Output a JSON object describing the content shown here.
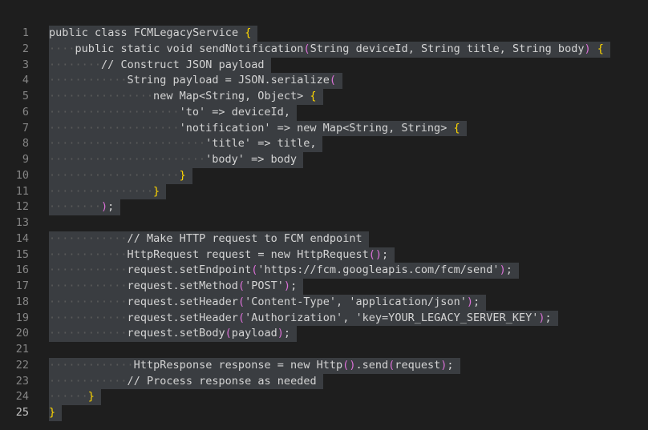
{
  "editor": {
    "active_line": 25,
    "colors": {
      "bg": "#1e1e1e",
      "text": "#d4d4d4",
      "bracket1": "#ffd700",
      "bracket2": "#da70d6",
      "bracket3": "#179fff",
      "selection": "#3a3d41"
    },
    "lines": [
      {
        "n": "1",
        "indent": 0,
        "text": "public class FCMLegacyService {"
      },
      {
        "n": "2",
        "indent": 4,
        "text": "public static void sendNotification(String deviceId, String title, String body) {"
      },
      {
        "n": "3",
        "indent": 8,
        "text": "// Construct JSON payload"
      },
      {
        "n": "4",
        "indent": 12,
        "text": "String payload = JSON.serialize("
      },
      {
        "n": "5",
        "indent": 16,
        "text": "new Map<String, Object> {"
      },
      {
        "n": "6",
        "indent": 20,
        "text": "'to' => deviceId,"
      },
      {
        "n": "7",
        "indent": 20,
        "text": "'notification' => new Map<String, String> {"
      },
      {
        "n": "8",
        "indent": 24,
        "text": "'title' => title,"
      },
      {
        "n": "9",
        "indent": 24,
        "text": "'body' => body"
      },
      {
        "n": "10",
        "indent": 20,
        "text": "}"
      },
      {
        "n": "11",
        "indent": 16,
        "text": "}"
      },
      {
        "n": "12",
        "indent": 8,
        "text": ");"
      },
      {
        "n": "13",
        "indent": 0,
        "text": ""
      },
      {
        "n": "14",
        "indent": 12,
        "text": "// Make HTTP request to FCM endpoint"
      },
      {
        "n": "15",
        "indent": 12,
        "text": "HttpRequest request = new HttpRequest();"
      },
      {
        "n": "16",
        "indent": 12,
        "text": "request.setEndpoint('https://fcm.googleapis.com/fcm/send');"
      },
      {
        "n": "17",
        "indent": 12,
        "text": "request.setMethod('POST');"
      },
      {
        "n": "18",
        "indent": 12,
        "text": "request.setHeader('Content-Type', 'application/json');"
      },
      {
        "n": "19",
        "indent": 12,
        "text": "request.setHeader('Authorization', 'key=YOUR_LEGACY_SERVER_KEY');"
      },
      {
        "n": "20",
        "indent": 12,
        "text": "request.setBody(payload);"
      },
      {
        "n": "21",
        "indent": 0,
        "text": ""
      },
      {
        "n": "22",
        "indent": 13,
        "text": "HttpResponse response = new Http().send(request);"
      },
      {
        "n": "23",
        "indent": 12,
        "text": "// Process response as needed"
      },
      {
        "n": "24",
        "indent": 6,
        "text": "}"
      },
      {
        "n": "25",
        "indent": 0,
        "text": "}"
      }
    ]
  }
}
